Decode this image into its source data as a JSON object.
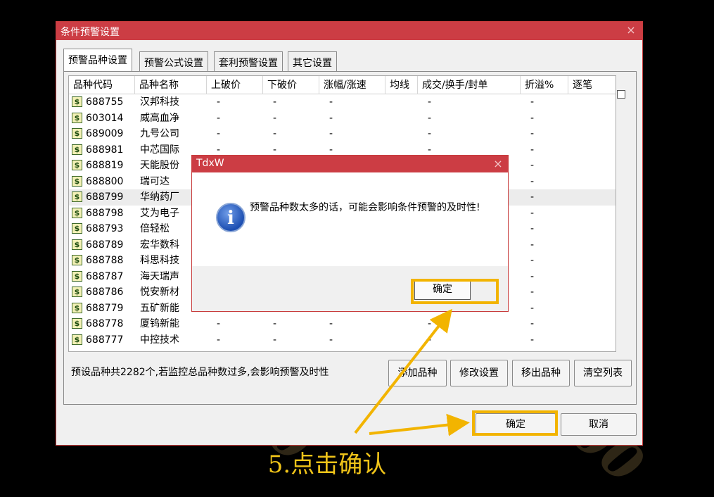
{
  "window": {
    "title": "条件预警设置",
    "close_glyph": "×"
  },
  "tabs": [
    {
      "label": "预警品种设置",
      "active": true
    },
    {
      "label": "预警公式设置",
      "active": false
    },
    {
      "label": "套利预警设置",
      "active": false
    },
    {
      "label": "其它设置",
      "active": false
    }
  ],
  "table": {
    "columns": [
      "品种代码",
      "品种名称",
      "上破价",
      "下破价",
      "涨幅/涨速",
      "均线",
      "成交/换手/封单",
      "折溢%",
      "逐笔"
    ],
    "rows": [
      {
        "code": "688755",
        "name": "汉邦科技",
        "up": "-",
        "down": "-",
        "chg": "-",
        "vol": "-",
        "prem": "-"
      },
      {
        "code": "603014",
        "name": "威高血净",
        "up": "-",
        "down": "-",
        "chg": "-",
        "vol": "-",
        "prem": "-"
      },
      {
        "code": "689009",
        "name": "九号公司",
        "up": "-",
        "down": "-",
        "chg": "-",
        "vol": "-",
        "prem": "-"
      },
      {
        "code": "688981",
        "name": "中芯国际",
        "up": "-",
        "down": "-",
        "chg": "-",
        "vol": "-",
        "prem": "-"
      },
      {
        "code": "688819",
        "name": "天能股份",
        "up": "",
        "down": "",
        "chg": "",
        "vol": "",
        "prem": "-"
      },
      {
        "code": "688800",
        "name": "瑞可达",
        "up": "",
        "down": "",
        "chg": "",
        "vol": "",
        "prem": "-"
      },
      {
        "code": "688799",
        "name": "华纳药厂",
        "up": "",
        "down": "",
        "chg": "",
        "vol": "",
        "prem": "-"
      },
      {
        "code": "688798",
        "name": "艾为电子",
        "up": "",
        "down": "",
        "chg": "",
        "vol": "",
        "prem": "-"
      },
      {
        "code": "688793",
        "name": "倍轻松",
        "up": "",
        "down": "",
        "chg": "",
        "vol": "",
        "prem": "-"
      },
      {
        "code": "688789",
        "name": "宏华数科",
        "up": "",
        "down": "",
        "chg": "",
        "vol": "",
        "prem": "-"
      },
      {
        "code": "688788",
        "name": "科思科技",
        "up": "",
        "down": "",
        "chg": "",
        "vol": "",
        "prem": "-"
      },
      {
        "code": "688787",
        "name": "海天瑞声",
        "up": "",
        "down": "",
        "chg": "",
        "vol": "",
        "prem": "-"
      },
      {
        "code": "688786",
        "name": "悦安新材",
        "up": "",
        "down": "",
        "chg": "",
        "vol": "",
        "prem": "-"
      },
      {
        "code": "688779",
        "name": "五矿新能",
        "up": "",
        "down": "",
        "chg": "",
        "vol": "",
        "prem": "-"
      },
      {
        "code": "688778",
        "name": "厦钨新能",
        "up": "-",
        "down": "-",
        "chg": "-",
        "vol": "-",
        "prem": "-"
      },
      {
        "code": "688777",
        "name": "中控技术",
        "up": "-",
        "down": "-",
        "chg": "-",
        "vol": "-",
        "prem": "-"
      }
    ],
    "selected_row_index": 6,
    "stock_icon_glyph": "$"
  },
  "status_text": "预设品种共2282个,若监控总品种数过多,会影响预警及时性",
  "actions": {
    "add": "添加品种",
    "modify": "修改设置",
    "remove": "移出品种",
    "clear": "清空列表"
  },
  "footer": {
    "ok": "确定",
    "cancel": "取消"
  },
  "dialog": {
    "title": "TdxW",
    "close_glyph": "×",
    "icon_glyph": "i",
    "message": "预警品种数太多的话，可能会影响条件预警的及时性!",
    "ok": "确定"
  },
  "caption": "5.点击确认",
  "colors": {
    "titlebar": "#cc3d44",
    "highlight": "#f2b400",
    "caption": "#f0c419"
  }
}
